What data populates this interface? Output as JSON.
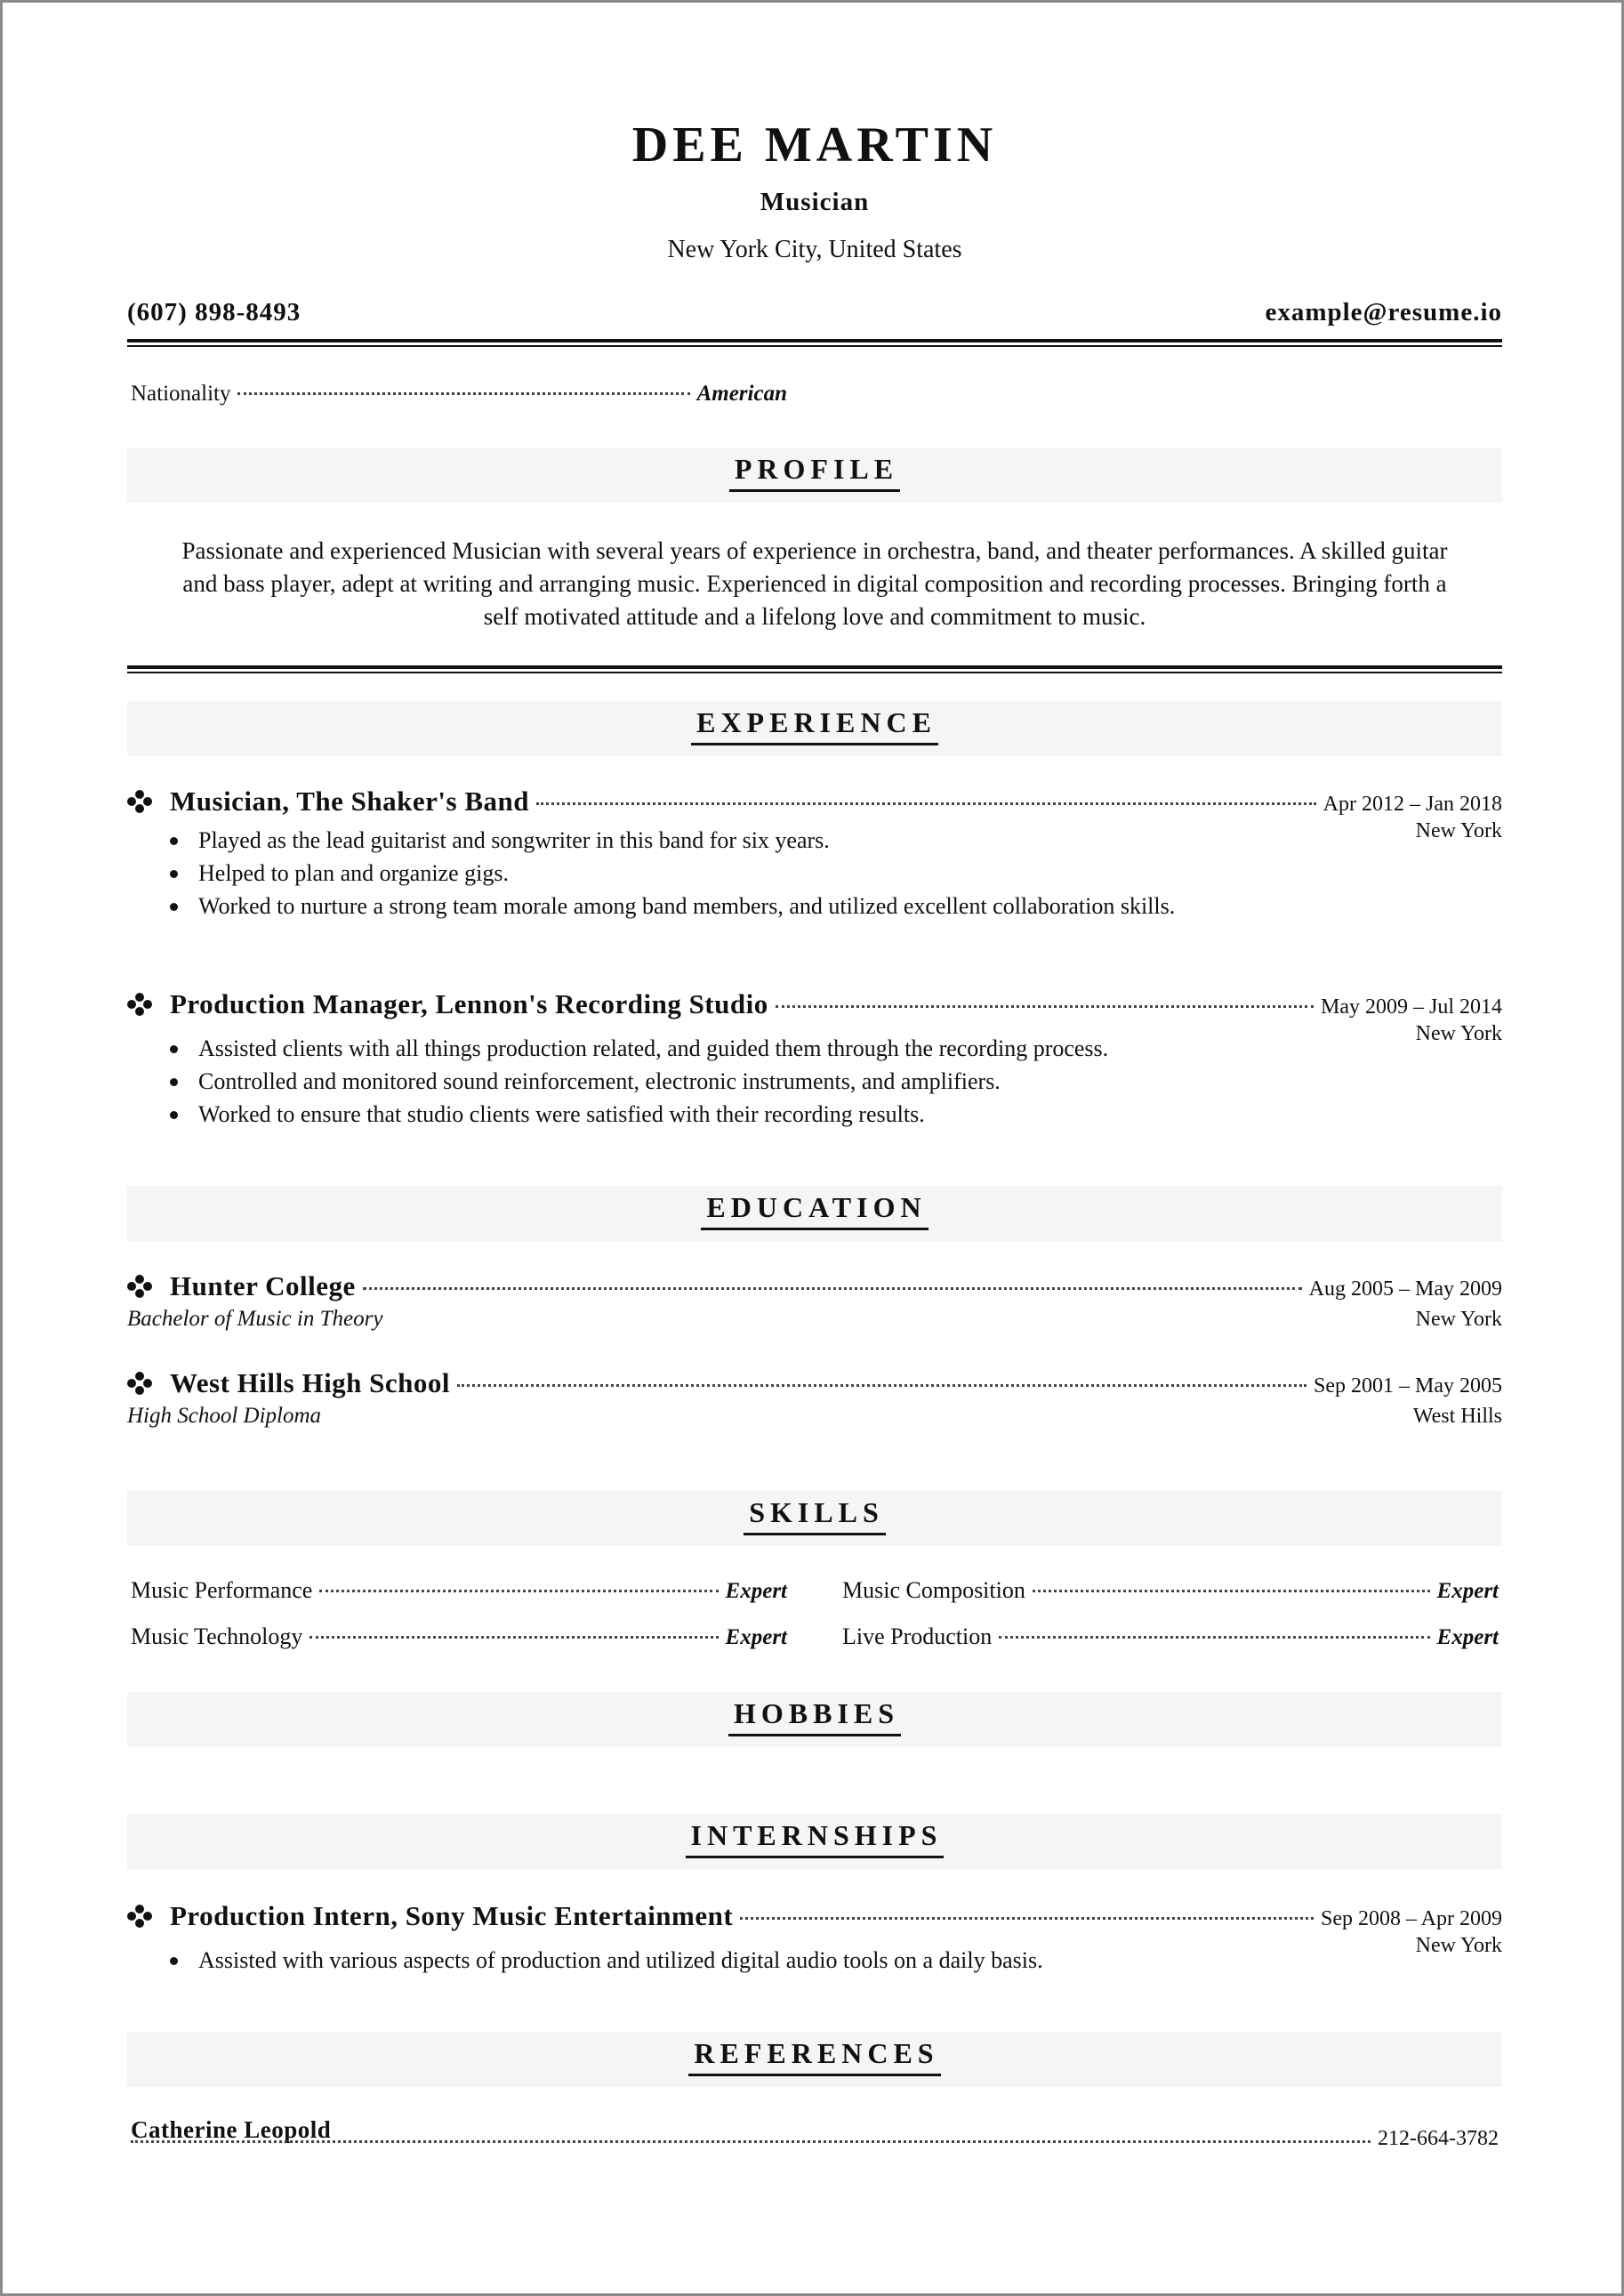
{
  "header": {
    "name": "DEE MARTIN",
    "job_title": "Musician",
    "location": "New York City, United States",
    "phone": "(607) 898-8493",
    "email": "example@resume.io"
  },
  "details": {
    "nationality_label": "Nationality",
    "nationality_value": "American"
  },
  "profile": {
    "heading": "PROFILE",
    "text": "Passionate and experienced Musician with several years of experience in orchestra, band, and theater performances. A skilled guitar and bass player, adept at writing and arranging music. Experienced in digital composition and recording processes. Bringing forth a self motivated attitude and a lifelong love and commitment to music."
  },
  "experience": {
    "heading": "EXPERIENCE",
    "items": [
      {
        "title": "Musician, The Shaker's Band",
        "dates": "Apr 2012 – Jan 2018",
        "location": "New York",
        "bullets": [
          "Played as the lead guitarist and songwriter in this band for six years.",
          "Helped to plan and organize gigs.",
          "Worked to nurture a strong team morale among band members, and utilized excellent collaboration skills."
        ]
      },
      {
        "title": "Production Manager, Lennon's Recording Studio",
        "dates": "May 2009 – Jul 2014",
        "location": "New York",
        "bullets": [
          "Assisted clients with all things production related, and guided them through the recording process.",
          "Controlled and monitored sound reinforcement, electronic instruments, and amplifiers.",
          "Worked to ensure that studio clients were satisfied with their recording results."
        ]
      }
    ]
  },
  "education": {
    "heading": "EDUCATION",
    "items": [
      {
        "school": "Hunter College",
        "degree": "Bachelor of Music in Theory",
        "dates": "Aug 2005 – May 2009",
        "location": "New York"
      },
      {
        "school": "West Hills High School",
        "degree": "High School Diploma",
        "dates": "Sep 2001 – May 2005",
        "location": "West Hills"
      }
    ]
  },
  "skills": {
    "heading": "SKILLS",
    "items": [
      {
        "name": "Music Performance",
        "level": "Expert"
      },
      {
        "name": "Music Composition",
        "level": "Expert"
      },
      {
        "name": "Music Technology",
        "level": "Expert"
      },
      {
        "name": "Live Production",
        "level": "Expert"
      }
    ]
  },
  "hobbies": {
    "heading": "HOBBIES"
  },
  "internships": {
    "heading": "INTERNSHIPS",
    "items": [
      {
        "title": "Production Intern, Sony Music Entertainment",
        "dates": "Sep 2008 – Apr 2009",
        "location": "New York",
        "bullets": [
          "Assisted with various aspects of production and utilized digital audio tools on a daily basis."
        ]
      }
    ]
  },
  "references": {
    "heading": "REFERENCES",
    "items": [
      {
        "name": "Catherine Leopold",
        "phone": "212-664-3782"
      }
    ]
  }
}
